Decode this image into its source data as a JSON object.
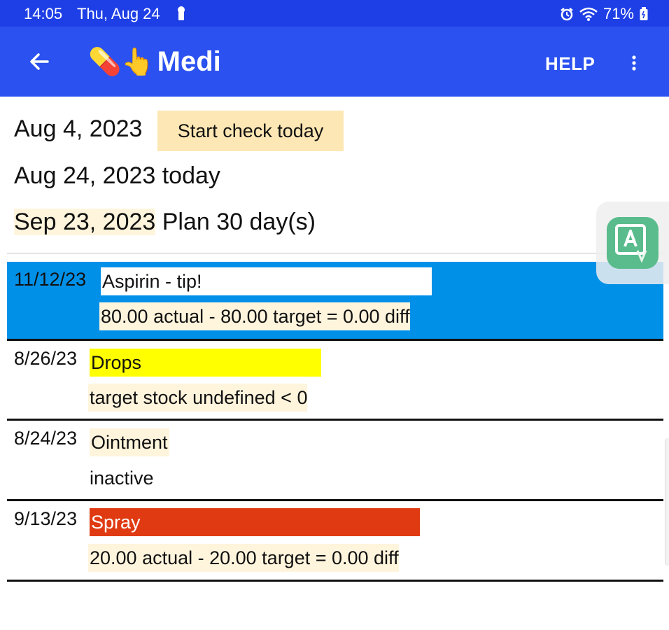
{
  "status": {
    "time": "14:05",
    "date": "Thu, Aug 24",
    "battery": "71%"
  },
  "appbar": {
    "emoji": "💊👆",
    "title": "Medi",
    "help": "HELP"
  },
  "summary": {
    "start_date": "Aug 4, 2023",
    "start_button": "Start check today",
    "today": "Aug 24, 2023 today",
    "plan_date": "Sep 23, 2023",
    "plan_text": " Plan 30 day(s)"
  },
  "rows": [
    {
      "date": "11/12/23",
      "name": "Aspirin - tip!",
      "detail": "80.00 actual - 80.00 target = 0.00 diff"
    },
    {
      "date": "8/26/23",
      "name": "Drops",
      "detail": "target stock undefined < 0"
    },
    {
      "date": "8/24/23",
      "name": "Ointment",
      "detail": "inactive"
    },
    {
      "date": "9/13/23",
      "name": "Spray",
      "detail": "20.00 actual - 20.00 target = 0.00 diff"
    }
  ],
  "colors": {
    "statusbar": "#1e3fe6",
    "appbar": "#2b52f0",
    "selected_row": "#0090e8",
    "drops": "#ffff00",
    "spray": "#e03a12",
    "cream": "#fff5dd",
    "start_button": "#fde7b4"
  },
  "icons": {
    "back": "arrow-left-icon",
    "more": "more-vert-icon",
    "floating": "translate-app-icon"
  }
}
